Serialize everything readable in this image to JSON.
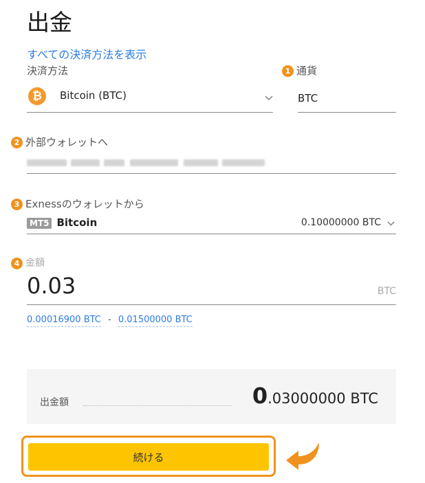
{
  "page": {
    "title": "出金"
  },
  "links": {
    "show_all_methods": "すべての決済方法を表示"
  },
  "payment_method": {
    "label": "決済方法",
    "value": "Bitcoin (BTC)",
    "icon": "bitcoin-icon"
  },
  "currency": {
    "step": "1",
    "label": "通貨",
    "value": "BTC"
  },
  "external_wallet": {
    "step": "2",
    "label": "外部ウォレットへ"
  },
  "from_wallet": {
    "step": "3",
    "label": "Exnessのウォレットから",
    "platform_badge": "MT5",
    "account_name": "Bitcoin",
    "balance": "0.10000000 BTC"
  },
  "amount": {
    "step": "4",
    "label": "金額",
    "value": "0.03",
    "unit": "BTC",
    "min": "0.00016900 BTC",
    "separator": "-",
    "max": "0.01500000 BTC"
  },
  "summary": {
    "label": "出金額",
    "amount_int": "0",
    "amount_frac": ".03000000 BTC"
  },
  "continue_button": {
    "label": "続ける"
  },
  "colors": {
    "accent": "#f0921e",
    "button": "#ffc400",
    "link": "#2c7be5"
  }
}
